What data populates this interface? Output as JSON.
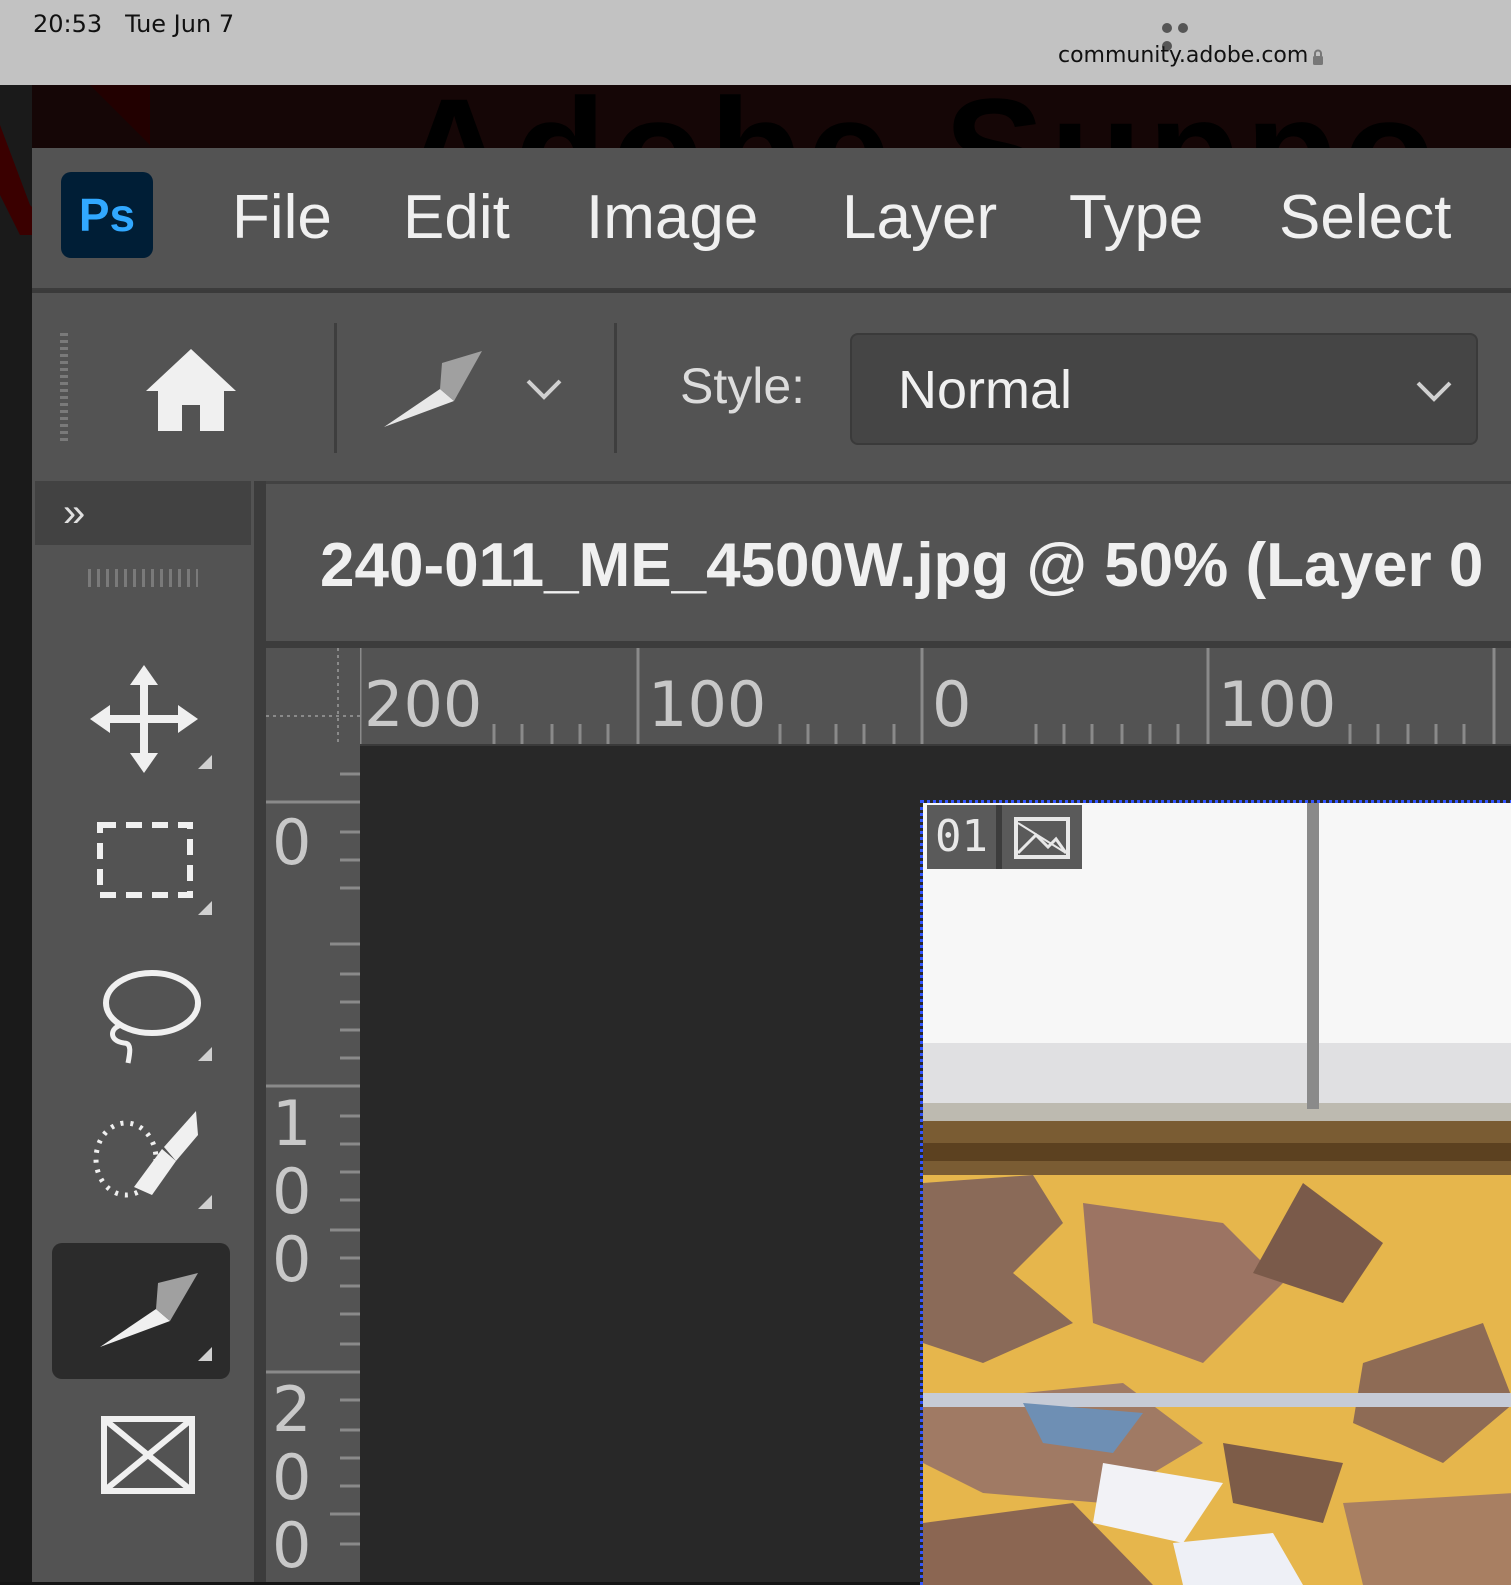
{
  "status_bar": {
    "time": "20:53",
    "date": "Tue Jun 7",
    "url": "community.adobe.com"
  },
  "background_page": {
    "heading": "Adobe Suppo"
  },
  "app": {
    "logo": "Ps",
    "menu": [
      "File",
      "Edit",
      "Image",
      "Layer",
      "Type",
      "Select"
    ]
  },
  "options_bar": {
    "style_label": "Style:",
    "style_value": "Normal"
  },
  "tools": [
    {
      "name": "move-tool",
      "active": false
    },
    {
      "name": "rectangular-marquee-tool",
      "active": false
    },
    {
      "name": "lasso-tool",
      "active": false
    },
    {
      "name": "object-selection-tool",
      "active": false
    },
    {
      "name": "pen-tool",
      "active": true
    },
    {
      "name": "frame-tool",
      "active": false
    }
  ],
  "document": {
    "tab_title": "240-011_ME_4500W.jpg @ 50% (Layer 0",
    "zoom": "50%",
    "layer_badge": "01"
  },
  "rulers": {
    "top": [
      "200",
      "100",
      "0",
      "100"
    ],
    "left": [
      "0",
      "100",
      "200"
    ]
  },
  "colors": {
    "ps_logo_bg": "#001e36",
    "ps_logo_text": "#31a8ff",
    "panel": "#535353",
    "canvas": "#282828"
  }
}
